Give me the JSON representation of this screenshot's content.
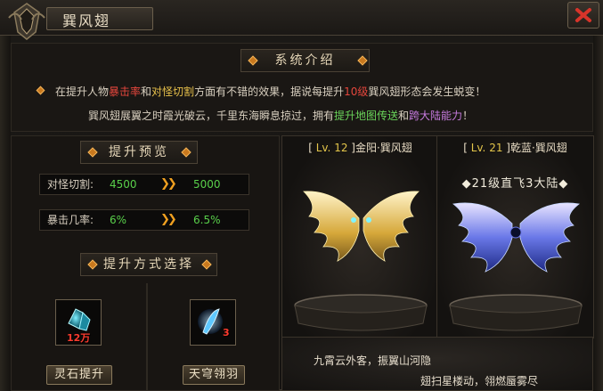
{
  "window": {
    "title": "巽风翅"
  },
  "intro": {
    "header": "系统介绍",
    "line1_a": "在提升人物",
    "line1_b": "暴击率",
    "line1_c": "和",
    "line1_d": "对怪切割",
    "line1_e": "方面有不错的效果，据说每提升",
    "line1_f": "10级",
    "line1_g": "巽风翅",
    "line1_h": "形态会发生蜕变！",
    "line2_a": "巽风翅展翼之时霞光破云，千里东海瞬息掠过，拥有",
    "line2_b": "提升地图传送",
    "line2_c": "和",
    "line2_d": "跨大陆能力",
    "line2_e": "！"
  },
  "preview": {
    "header": "提升预览",
    "stats": [
      {
        "label": "对怪切割:",
        "current": "4500",
        "next": "5000"
      },
      {
        "label": "暴击几率:",
        "current": "6%",
        "next": "6.5%"
      }
    ]
  },
  "upgrade": {
    "header": "提升方式选择",
    "options": [
      {
        "icon": "crystal-icon",
        "count": "12万",
        "button": "灵石提升"
      },
      {
        "icon": "feather-icon",
        "count": "3",
        "button": "天穹翎羽"
      }
    ]
  },
  "wings": {
    "current": {
      "lv_prefix": "[ ",
      "lv": "Lv. 12",
      "lv_suffix": " ]",
      "name": "金阳·巽风翅"
    },
    "next": {
      "lv_prefix": "[ ",
      "lv": "Lv. 21",
      "lv_suffix": " ]",
      "name": "乾蓝·巽风翅",
      "caption": "◆21级直飞3大陆◆"
    }
  },
  "poem": {
    "line1": "九霄云外客，振翼山河隐",
    "line2": "翅扫星楼动，翎燃蜃雾尽"
  },
  "colors": {
    "accent_orange": "#f0a020",
    "stat_green": "#59d04a",
    "highlight_red": "#e3463c",
    "level_yellow": "#e3c54a"
  }
}
